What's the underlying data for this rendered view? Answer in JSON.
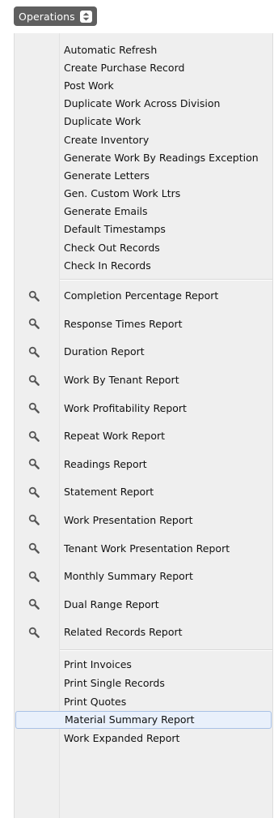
{
  "operations_button": {
    "label": "Operations"
  },
  "menu": {
    "section_actions": [
      {
        "label": "Automatic Refresh"
      },
      {
        "label": "Create Purchase Record"
      },
      {
        "label": "Post Work"
      },
      {
        "label": "Duplicate Work Across Division"
      },
      {
        "label": "Duplicate Work"
      },
      {
        "label": "Create Inventory"
      },
      {
        "label": "Generate Work By Readings Exception"
      },
      {
        "label": "Generate Letters"
      },
      {
        "label": "Gen. Custom Work Ltrs"
      },
      {
        "label": "Generate Emails"
      },
      {
        "label": "Default Timestamps"
      },
      {
        "label": "Check Out Records"
      },
      {
        "label": "Check In Records"
      }
    ],
    "section_reports": [
      {
        "label": "Completion Percentage Report",
        "icon": "search-icon"
      },
      {
        "label": "Response Times Report",
        "icon": "search-icon"
      },
      {
        "label": "Duration Report",
        "icon": "search-icon"
      },
      {
        "label": "Work By Tenant Report",
        "icon": "search-icon"
      },
      {
        "label": "Work Profitability Report",
        "icon": "search-icon"
      },
      {
        "label": "Repeat Work Report",
        "icon": "search-icon"
      },
      {
        "label": "Readings Report",
        "icon": "search-icon"
      },
      {
        "label": "Statement Report",
        "icon": "search-icon"
      },
      {
        "label": "Work Presentation Report",
        "icon": "search-icon"
      },
      {
        "label": "Tenant Work Presentation Report",
        "icon": "search-icon"
      },
      {
        "label": "Monthly Summary Report",
        "icon": "search-icon"
      },
      {
        "label": "Dual Range Report",
        "icon": "search-icon"
      },
      {
        "label": "Related Records Report",
        "icon": "search-icon"
      }
    ],
    "section_print": [
      {
        "label": "Print Invoices"
      },
      {
        "label": "Print Single Records"
      },
      {
        "label": "Print Quotes"
      },
      {
        "label": "Material Summary Report",
        "selected": true
      },
      {
        "label": "Work Expanded Report"
      }
    ]
  },
  "colors": {
    "button_bg": "#5f5f5f",
    "menu_bg": "#efefef",
    "selected_bg": "#e9f0fb",
    "selected_border": "#a9c1e6",
    "icon_color": "#555555"
  }
}
